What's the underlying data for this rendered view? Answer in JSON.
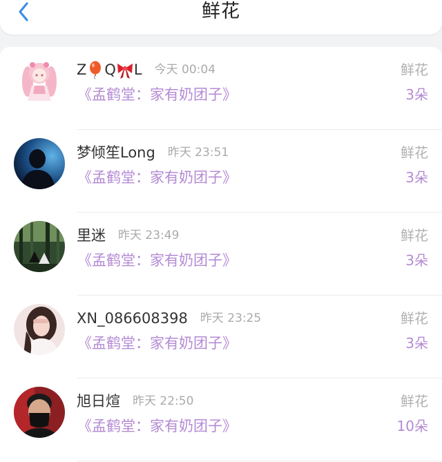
{
  "header": {
    "title": "鲜花",
    "back_icon": "chevron-left-icon",
    "accent_color": "#3a8ee6"
  },
  "gift_color": "#b48ad4",
  "records": [
    {
      "user": {
        "name_parts": [
          "Z",
          "Q",
          "L"
        ],
        "name_icons": [
          "balloon-icon",
          "bow-icon"
        ]
      },
      "time": "今天 00:04",
      "gift_name": "《孟鹤堂：家有奶团子》",
      "gift_label": "鲜花",
      "count": "3朵",
      "avatar": "anime-girl-avatar"
    },
    {
      "user": {
        "name": "梦倾笙Long"
      },
      "time": "昨天 23:51",
      "gift_name": "《孟鹤堂：家有奶团子》",
      "gift_label": "鲜花",
      "count": "3朵",
      "avatar": "silhouette-avatar"
    },
    {
      "user": {
        "name": "里迷"
      },
      "time": "昨天 23:49",
      "gift_name": "《孟鹤堂：家有奶团子》",
      "gift_label": "鲜花",
      "count": "3朵",
      "avatar": "forest-scene-avatar"
    },
    {
      "user": {
        "name": "XN_086608398"
      },
      "time": "昨天 23:25",
      "gift_name": "《孟鹤堂：家有奶团子》",
      "gift_label": "鲜花",
      "count": "3朵",
      "avatar": "girl-photo-avatar"
    },
    {
      "user": {
        "name": "旭日煊"
      },
      "time": "昨天 22:50",
      "gift_name": "《孟鹤堂：家有奶团子》",
      "gift_label": "鲜花",
      "count": "10朵",
      "avatar": "masked-man-avatar"
    }
  ]
}
